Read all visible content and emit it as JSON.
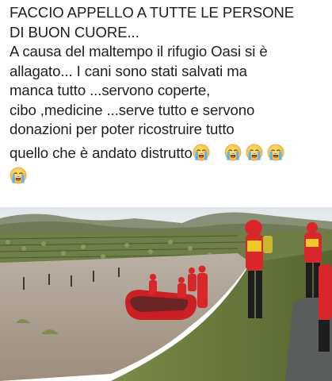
{
  "post": {
    "lines": [
      "FACCIO APPELLO A TUTTE LE PERSONE",
      "DI BUON CUORE...",
      "A causa del maltempo il rifugio Oasi si è",
      "allagato... I cani sono stati salvati ma",
      "manca tutto ...servono coperte,",
      "cibo ,medicine ...serve tutto e servono",
      "donazioni per poter ricostruire tutto",
      "quello che  è andato distrutto"
    ],
    "trailing_emoji": [
      "crying-face-icon",
      "crying-face-icon",
      "crying-face-icon",
      "crying-face-icon",
      "crying-face-icon"
    ]
  },
  "photo": {
    "subject": "flood-rescue-photo"
  },
  "colors": {
    "text": "#1c1e21",
    "rescue_red": "#d8262b",
    "water": "#a8998a",
    "sky": "#e9edf0"
  }
}
